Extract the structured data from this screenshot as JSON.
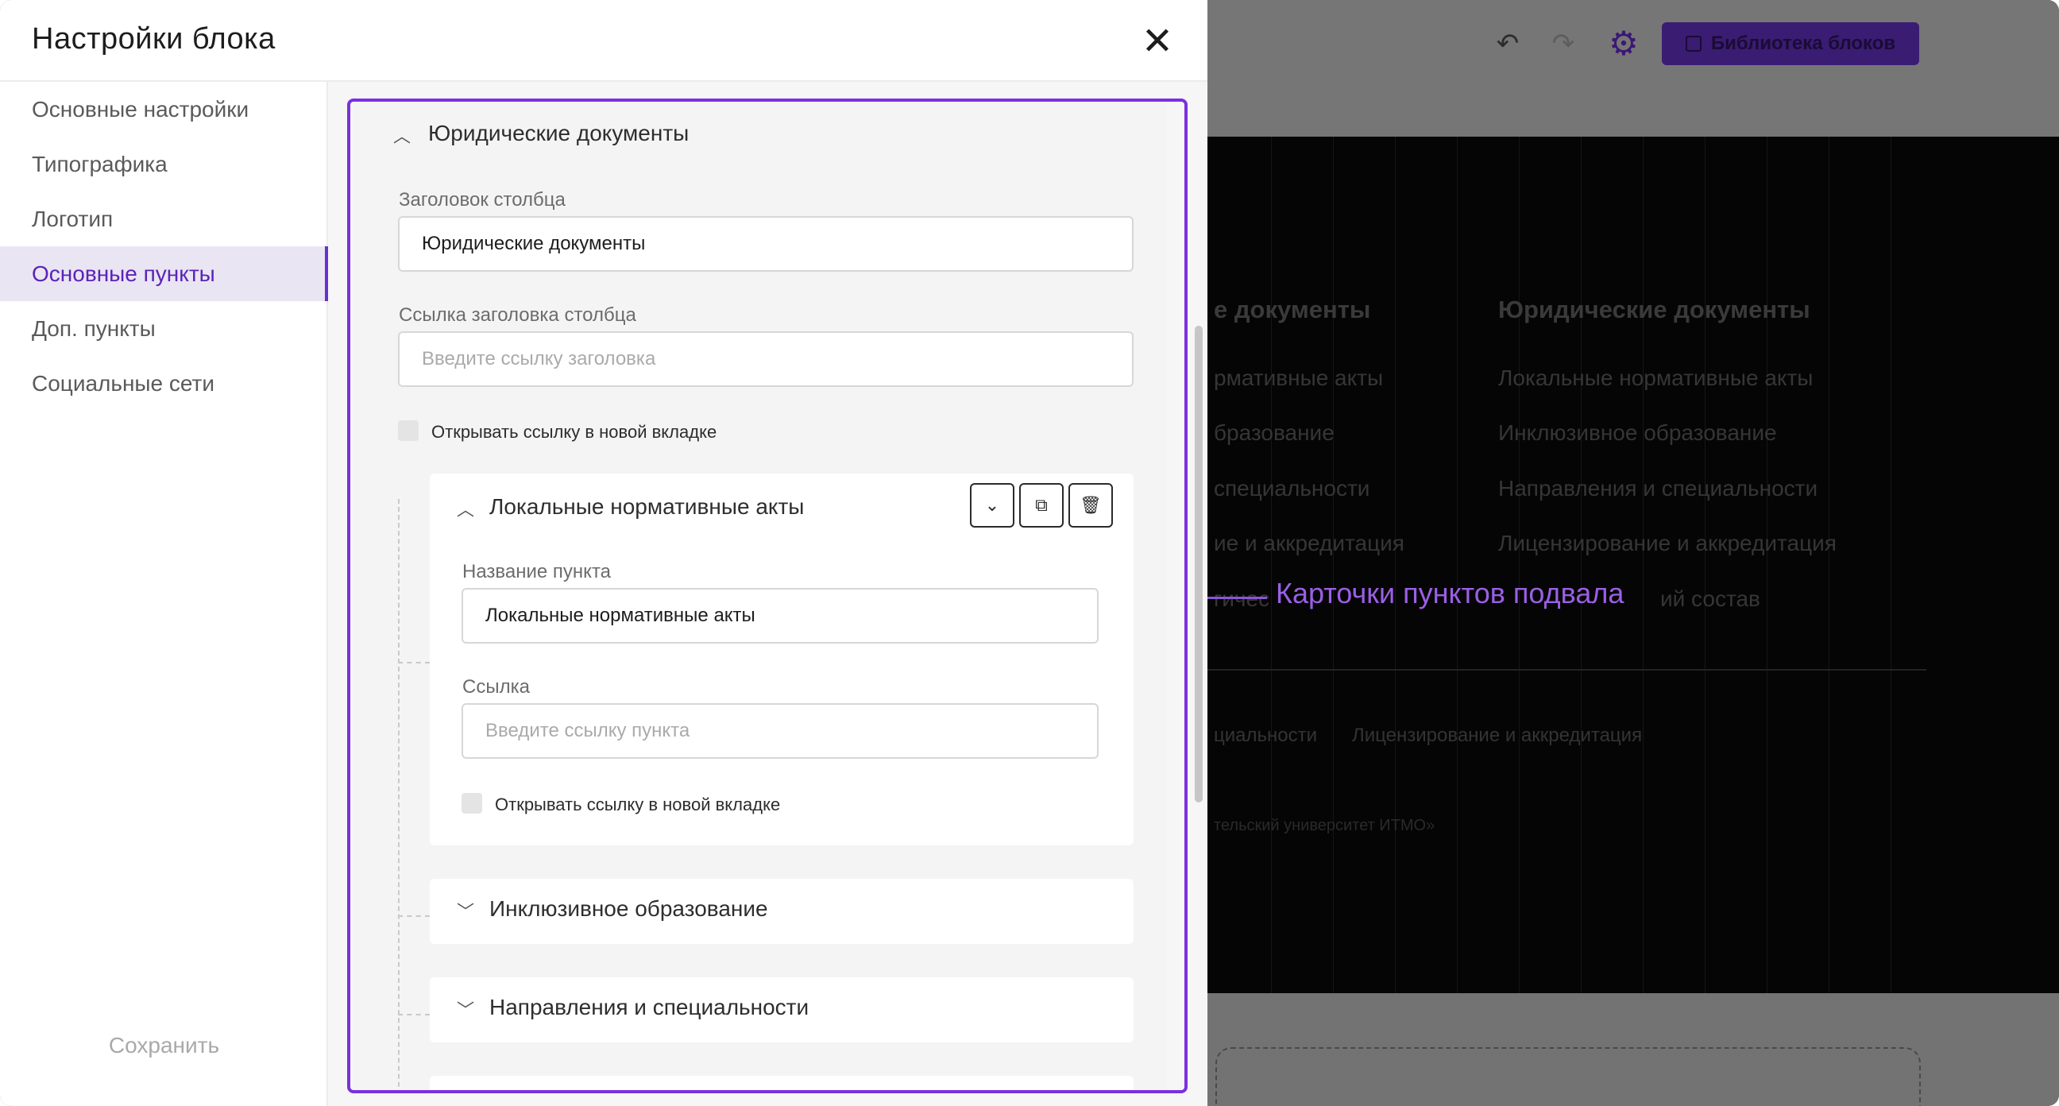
{
  "modal": {
    "title": "Настройки блока",
    "close_glyph": "✕"
  },
  "sidebar": {
    "items": [
      {
        "label": "Основные настройки"
      },
      {
        "label": "Типографика"
      },
      {
        "label": "Логотип"
      },
      {
        "label": "Основные пункты",
        "active": true
      },
      {
        "label": "Доп. пункты"
      },
      {
        "label": "Социальные сети"
      }
    ],
    "save_label": "Сохранить"
  },
  "section": {
    "title": "Юридические документы",
    "column_title_label": "Заголовок столбца",
    "column_title_value": "Юридические документы",
    "column_link_label": "Ссылка заголовка столбца",
    "column_link_placeholder": "Введите ссылку заголовка",
    "new_tab_label": "Открывать ссылку в новой вкладке"
  },
  "cards": [
    {
      "title": "Локальные нормативные акты",
      "expanded": true,
      "name_label": "Название пункта",
      "name_value": "Локальные нормативные акты",
      "link_label": "Ссылка",
      "link_placeholder": "Введите ссылку пункта",
      "new_tab_label": "Открывать ссылку в новой вкладке"
    },
    {
      "title": "Инклюзивное образование",
      "expanded": false
    },
    {
      "title": "Направления и специальности",
      "expanded": false
    }
  ],
  "toolbar": {
    "library_label": "Библиотека блоков",
    "undo_icon": "undo-icon",
    "redo_icon": "redo-icon",
    "settings_icon": "gear-icon"
  },
  "preview": {
    "col1_head": "е документы",
    "col1_items": [
      "рмативные акты",
      "бразование",
      "специальности",
      "ие и аккредитация",
      "гичес"
    ],
    "col2_head": "Юридические документы",
    "col2_items": [
      "Локальные нормативные акты",
      "Инклюзивное образование",
      "Направления и специальности",
      "Лицензирование и аккредитация",
      "ий состав"
    ],
    "bottom_links": [
      "циальности",
      "Лицензирование и аккредитация"
    ],
    "copyright": "тельский университет ИТМО»"
  },
  "annotation": {
    "text": "Карточки пунктов подвала"
  },
  "colors": {
    "accent": "#6a2fd0",
    "highlight_border": "#7b2fe0",
    "annotation": "#9a5fe6"
  }
}
